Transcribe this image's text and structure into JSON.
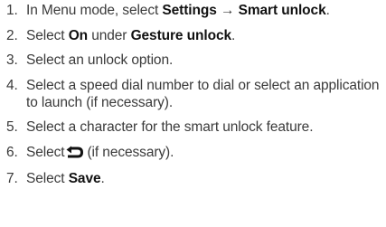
{
  "steps": [
    {
      "number": "1.",
      "parts": {
        "t1": "In Menu mode, select ",
        "b1": "Settings",
        "t2": " → ",
        "b2": "Smart unlock",
        "t3": "."
      }
    },
    {
      "number": "2.",
      "parts": {
        "t1": "Select ",
        "b1": "On",
        "t2": " under ",
        "b2": "Gesture unlock",
        "t3": "."
      }
    },
    {
      "number": "3.",
      "text": "Select an unlock option."
    },
    {
      "number": "4.",
      "text": "Select a speed dial number to dial or select an application to launch (if necessary)."
    },
    {
      "number": "5.",
      "text": "Select a character for the smart unlock feature."
    },
    {
      "number": "6.",
      "parts": {
        "t1": "Select",
        "icon": "back-arrow-icon",
        "t2": "(if necessary)."
      }
    },
    {
      "number": "7.",
      "parts": {
        "t1": "Select ",
        "b1": "Save",
        "t2": "."
      }
    }
  ]
}
